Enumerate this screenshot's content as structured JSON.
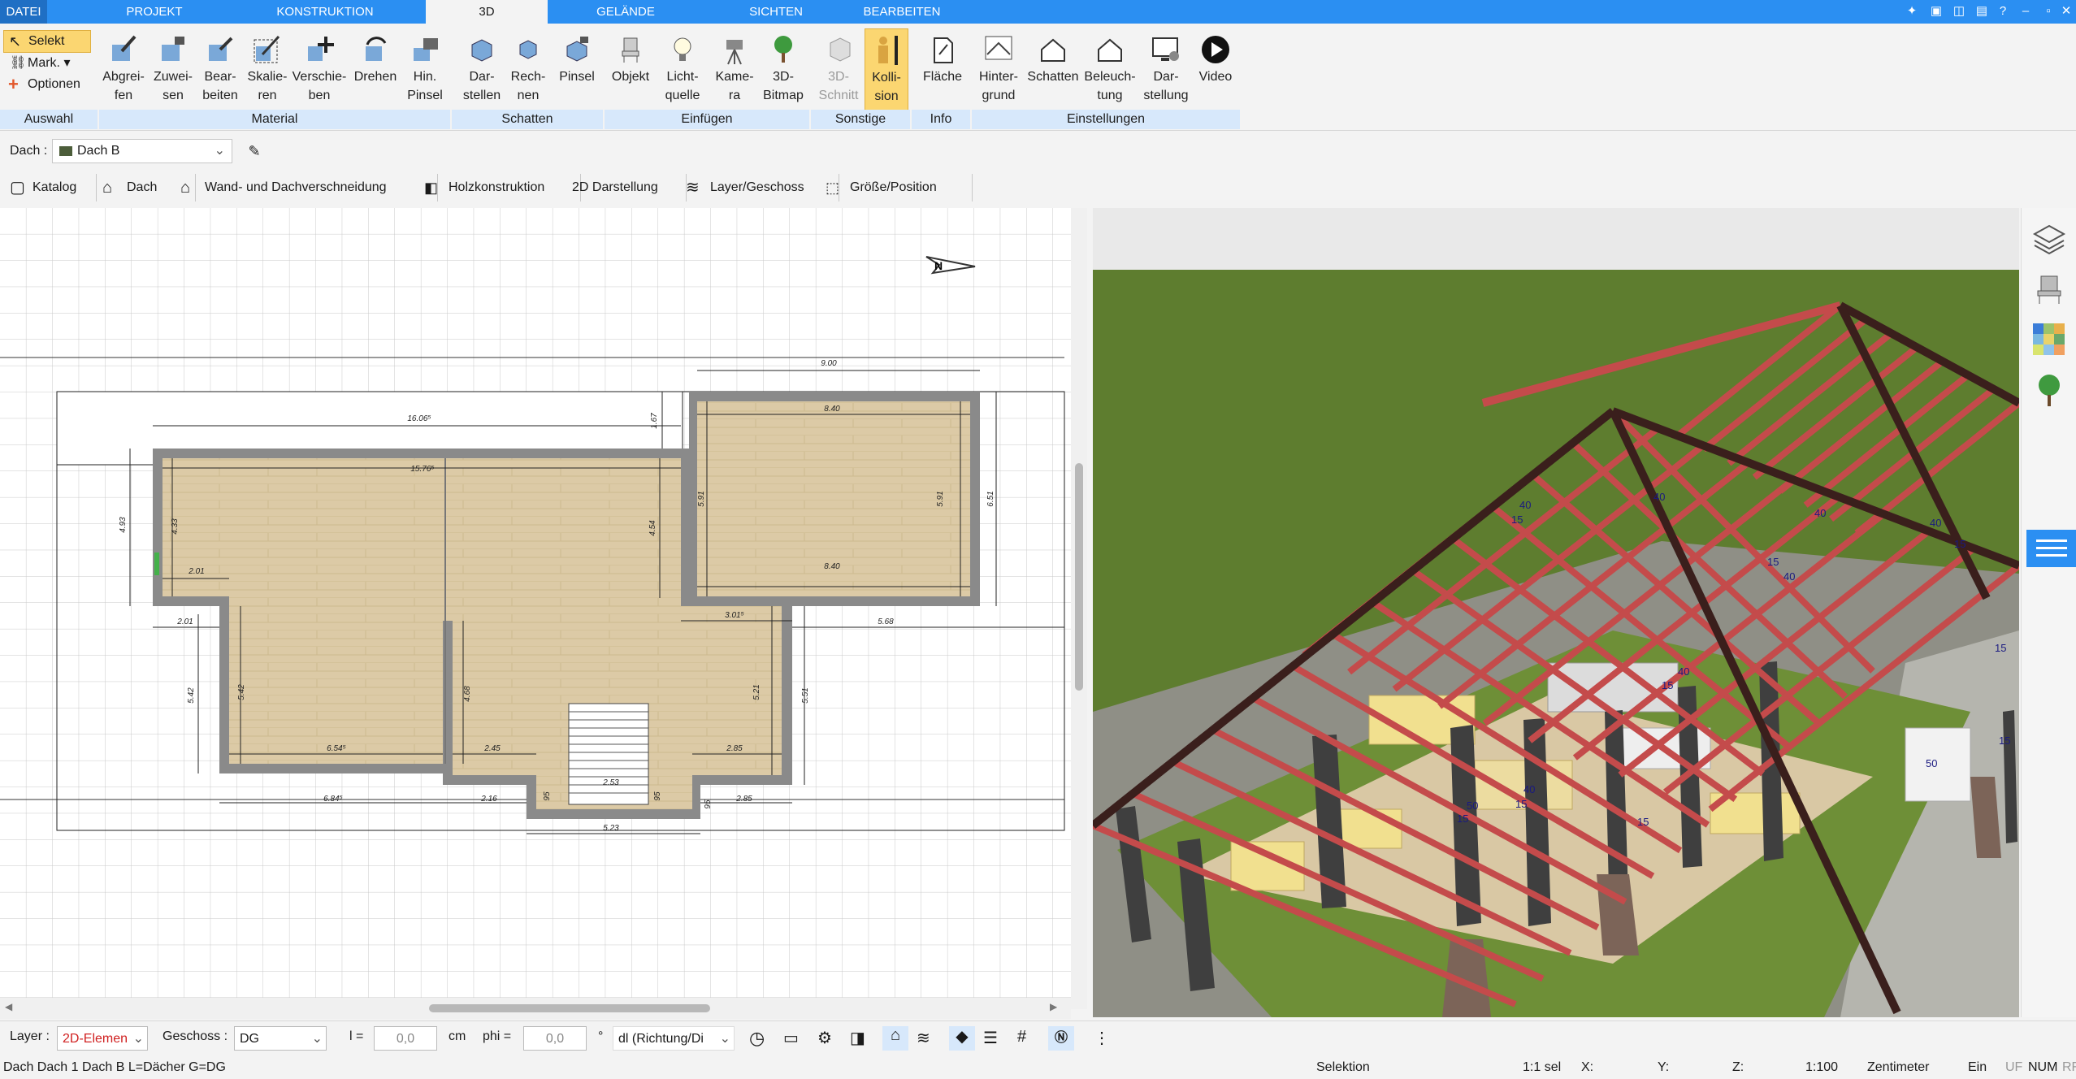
{
  "menu": {
    "tabs": [
      "DATEI",
      "PROJEKT",
      "KONSTRUKTION",
      "3D",
      "GELÄNDE",
      "SICHTEN",
      "BEARBEITEN"
    ],
    "active": "3D"
  },
  "selection": {
    "select": "Selekt",
    "mark": "Mark.",
    "options": "Optionen",
    "group": "Auswahl"
  },
  "ribbon": {
    "material": {
      "group": "Material",
      "buttons": [
        "Abgrei-\nfen",
        "Zuwei-\nsen",
        "Bear-\nbeiten",
        "Skalie-\nren",
        "Verschie-\nben",
        "Drehen",
        "Hin.\nPinsel"
      ]
    },
    "schatten": {
      "group": "Schatten",
      "buttons": [
        "Dar-\nstellen",
        "Rech-\nnen",
        "Pinsel"
      ]
    },
    "einfuegen": {
      "group": "Einfügen",
      "buttons": [
        "Objekt",
        "Licht-\nquelle",
        "Kame-\nra",
        "3D-\nBitmap"
      ]
    },
    "sonstige": {
      "group": "Sonstige",
      "buttons": [
        "3D-\nSchnitt",
        "Kolli-\nsion"
      ]
    },
    "info": {
      "group": "Info",
      "buttons": [
        "Fläche"
      ]
    },
    "einstellungen": {
      "group": "Einstellungen",
      "buttons": [
        "Hinter-\ngrund",
        "Schatten",
        "Beleuch-\ntung",
        "Dar-\nstellung",
        "Video"
      ]
    }
  },
  "object_bar": {
    "label": "Dach :",
    "value": "Dach B"
  },
  "toolbar2": [
    "Katalog",
    "Dach",
    "Wand- und Dachverschneidung",
    "Holzkonstruktion",
    "2D Darstellung",
    "Layer/Geschoss",
    "Größe/Position"
  ],
  "plan": {
    "dims": [
      "9.00",
      "16.06⁵",
      "1.67",
      "8.40",
      "15.76⁵",
      "5.91",
      "5.91",
      "6.51",
      "4.93",
      "4.33",
      "4.54",
      "8.40",
      "2.01",
      "2.01",
      "3.01⁵",
      "5.68",
      "5.42",
      "5.42",
      "4.68",
      "5.21",
      "5.51",
      "6.54⁵",
      "2.45",
      "2.85",
      "6.84⁵",
      "2.16",
      "95",
      "2.53",
      "95",
      "95",
      "2.85",
      "5.23"
    ]
  },
  "view3d": {
    "labels": [
      "40",
      "15",
      "40",
      "15",
      "40",
      "15",
      "40",
      "40",
      "50",
      "50",
      "50",
      "40",
      "15",
      "50",
      "50",
      "50",
      "15",
      "40",
      "15",
      "50",
      "15",
      "50",
      "15",
      "50",
      "15"
    ]
  },
  "bottom": {
    "layer_label": "Layer :",
    "layer_value": "2D-Elemen",
    "geschoss_label": "Geschoss :",
    "geschoss_value": "DG",
    "l_label": "l =",
    "l_value": "0,0",
    "l_unit": "cm",
    "phi_label": "phi =",
    "phi_value": "0,0",
    "phi_unit": "°",
    "dl_value": "dl (Richtung/Di"
  },
  "status": {
    "left": "Dach Dach 1 Dach B L=Dächer G=DG",
    "mode": "Selektion",
    "sel": "1:1 sel",
    "x": "X:",
    "y": "Y:",
    "z": "Z:",
    "scale": "1:100",
    "unit": "Zentimeter",
    "ein": "Ein",
    "uf": "UF",
    "num": "NUM",
    "rf": "RF"
  },
  "colors": {
    "accent": "#2b8ff2",
    "group_bg": "#d7e8fb",
    "selected": "#fbd671",
    "rafter": "#c94a4a",
    "grass": "#5e7d2f",
    "floor": "#d9c8a4",
    "wall": "#8a8a8a"
  }
}
